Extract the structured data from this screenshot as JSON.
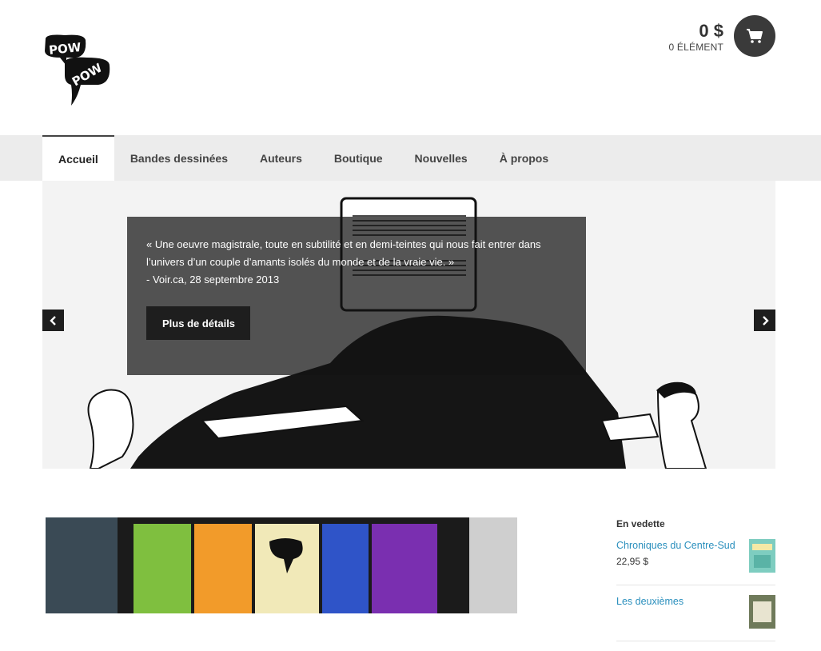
{
  "header": {
    "logo_text_top": "POW",
    "logo_text_bottom": "POW",
    "cart_amount": "0 $",
    "cart_count": "0 ÉLÉMENT",
    "cart_icon": "shopping-cart-icon"
  },
  "nav": {
    "items": [
      {
        "label": "Accueil",
        "active": true
      },
      {
        "label": "Bandes dessinées",
        "active": false
      },
      {
        "label": "Auteurs",
        "active": false
      },
      {
        "label": "Boutique",
        "active": false
      },
      {
        "label": "Nouvelles",
        "active": false
      },
      {
        "label": "À propos",
        "active": false
      }
    ]
  },
  "slider": {
    "quote": "« Une oeuvre magistrale, toute en subtilité et en demi-teintes qui nous fait entrer dans l’univers d’un couple d’amants isolés du monde et de la vraie vie. »",
    "source": "- Voir.ca, 28 septembre 2013",
    "button_label": "Plus de détails",
    "prev_icon": "chevron-left-icon",
    "next_icon": "chevron-right-icon"
  },
  "sidebar": {
    "title": "En vedette",
    "products": [
      {
        "name": "Chroniques du Centre-Sud",
        "price": "22,95 $",
        "thumb_color": "#7ecdc0"
      },
      {
        "name": "Les deuxièmes",
        "price": "",
        "thumb_color": "#6f7a5a"
      }
    ]
  },
  "colors": {
    "accent_link": "#2a8fbd",
    "nav_bg": "#ececec",
    "dark": "#1e1e1e"
  }
}
